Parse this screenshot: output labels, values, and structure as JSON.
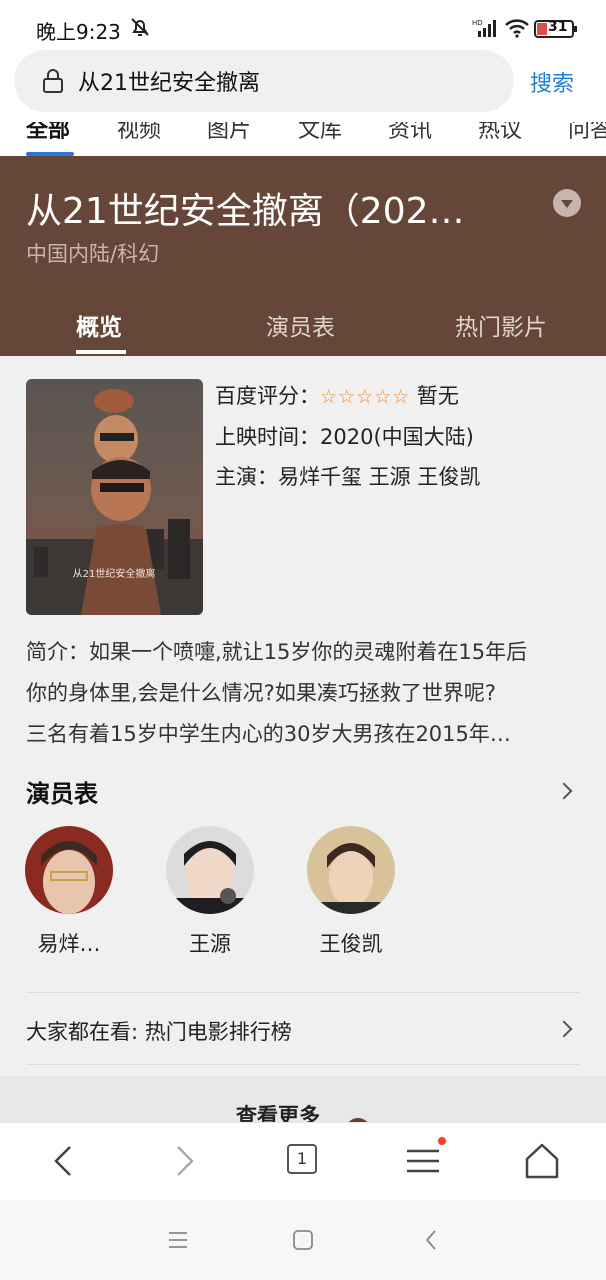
{
  "status_bar": {
    "time": "晚上9:23",
    "battery": "31"
  },
  "search": {
    "query": "从21世纪安全撤离",
    "button_label": "搜索"
  },
  "category_tabs": [
    "全部",
    "视频",
    "图片",
    "文库",
    "资讯",
    "热议",
    "问答"
  ],
  "movie": {
    "title": "从21世纪安全撤离（202…",
    "genre": "中国内陆/科幻",
    "sub_tabs": [
      "概览",
      "演员表",
      "热门影片"
    ],
    "poster_text": "从21世纪安全撤离",
    "rating_label": "百度评分：",
    "rating_stars": "☆☆☆☆☆",
    "rating_value": "暂无",
    "release": "上映时间：2020(中国大陆)",
    "cast_line": "主演：易烊千玺 王源 王俊凯",
    "description": [
      "简介：如果一个喷嚏,就让15岁你的灵魂附着在15年后",
      "你的身体里,会是什么情况?如果凑巧拯救了世界呢?",
      "三名有着15岁中学生内心的30岁大男孩在2015年…"
    ]
  },
  "cast_section": {
    "title": "演员表",
    "actors": [
      {
        "name": "易烊…"
      },
      {
        "name": "王源"
      },
      {
        "name": "王俊凯"
      }
    ]
  },
  "hot_section": {
    "label": "大家都在看: 热门电影排行榜"
  },
  "see_more": "查看更多",
  "browser_bar": {
    "tab_count": "1"
  },
  "colors": {
    "header_bg": "#664638",
    "accent_blue": "#1f7ed6",
    "star_orange": "#f08a30"
  }
}
